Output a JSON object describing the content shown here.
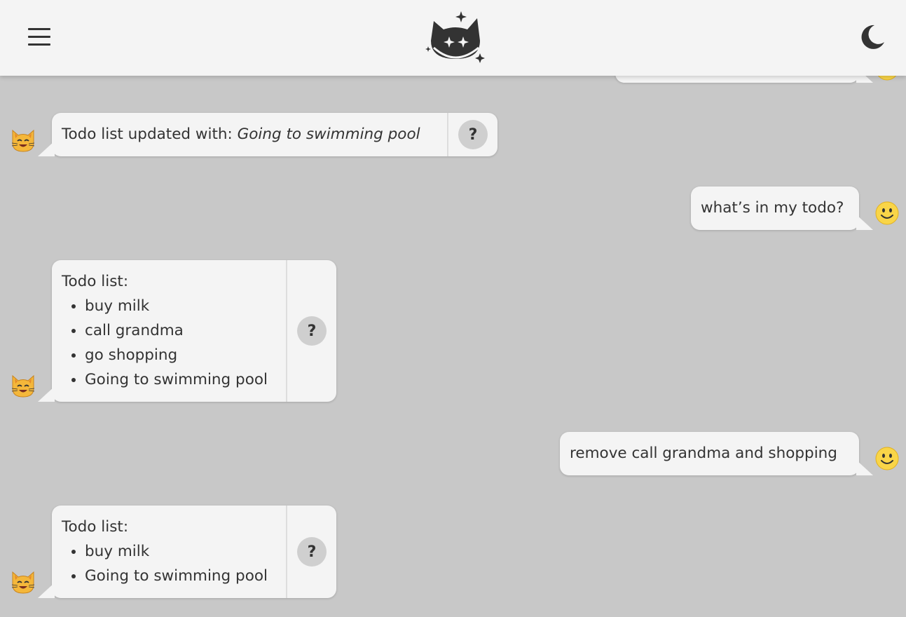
{
  "header": {
    "menu_icon": "hamburger-menu-icon",
    "logo_icon": "sparkle-cat-logo",
    "theme_icon": "moon-icon"
  },
  "messages": [
    {
      "role": "bot",
      "prefix": "Todo list updated with: ",
      "emphasis": "Going to swimming pool",
      "help": "?"
    },
    {
      "role": "user",
      "text": "what’s in my todo?"
    },
    {
      "role": "bot",
      "title": "Todo list:",
      "items": [
        "buy milk",
        "call grandma",
        "go shopping",
        "Going to swimming pool"
      ],
      "help": "?"
    },
    {
      "role": "user",
      "text": "remove call grandma and shopping"
    },
    {
      "role": "bot",
      "title": "Todo list:",
      "items": [
        "buy milk",
        "Going to swimming pool"
      ],
      "help": "?"
    }
  ],
  "colors": {
    "background": "#c8c8c8",
    "bubble": "#f4f4f4",
    "text": "#333333",
    "help_button": "#cfcfcf"
  }
}
